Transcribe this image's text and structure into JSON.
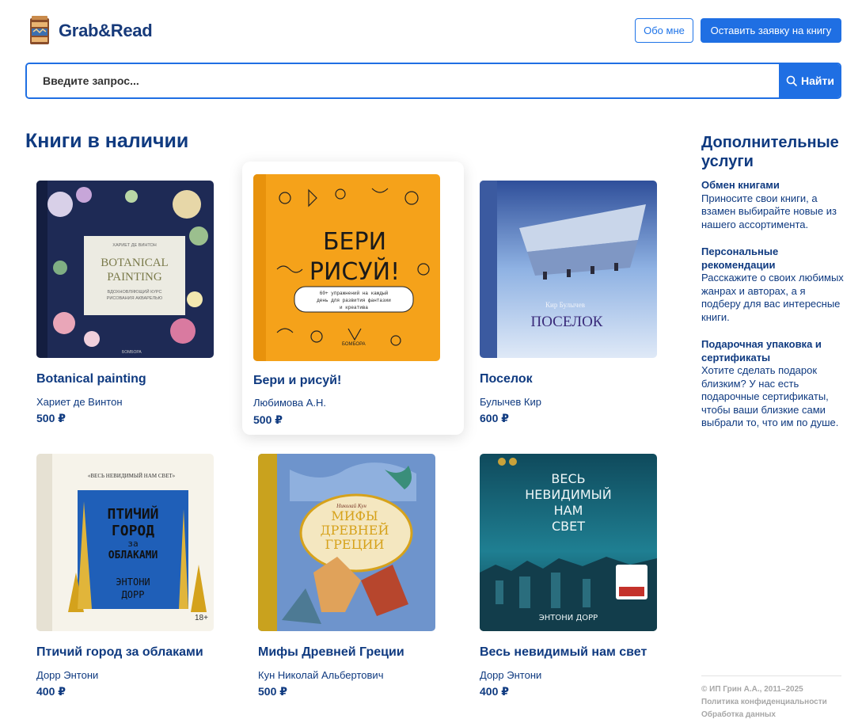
{
  "header": {
    "brand": "Grab&Read",
    "about_label": "Обо мне",
    "request_label": "Оставить заявку на книгу"
  },
  "search": {
    "placeholder": "Введите запрос...",
    "button_label": "Найти"
  },
  "catalog": {
    "title": "Книги в наличии",
    "books": [
      {
        "title": "Botanical painting",
        "author": "Хариет де Винтон",
        "price": "500 ₽",
        "cover_text": [
          "ХАРИЕТ ДЕ ВИНТОН",
          "BOTANICAL",
          "PAINTING",
          "ВДОХНОВЛЯЮЩИЙ КУРС",
          "РИСОВАНИЯ АКВАРЕЛЬЮ",
          "БОМБОРА"
        ]
      },
      {
        "title": "Бери и рисуй!",
        "author": "Любимова А.Н.",
        "price": "500 ₽",
        "cover_text": [
          "БЕРИ",
          "РИСУЙ!",
          "60+ упражнений на каждый",
          "день для развития фантазии",
          "и креатива",
          "БОМБОРА"
        ]
      },
      {
        "title": "Поселок",
        "author": "Булычев Кир",
        "price": "600 ₽",
        "cover_text": [
          "Кир Булычев",
          "ПОСЕЛОК"
        ]
      },
      {
        "title": "Птичий город за облаками",
        "author": "Дорр Энтони",
        "price": "400 ₽",
        "cover_text": [
          "«ВЕСЬ НЕВИДИМЫЙ НАМ СВЕТ»",
          "ПТИЧИЙ",
          "ГОРОД",
          "за",
          "ОБЛАКАМИ",
          "ЭНТОНИ",
          "ДОРР",
          "18+"
        ]
      },
      {
        "title": "Мифы Древней Греции",
        "author": "Кун Николай Альбертович",
        "price": "500 ₽",
        "cover_text": [
          "Николай Кун",
          "МИФЫ",
          "ДРЕВНЕЙ",
          "ГРЕЦИИ"
        ]
      },
      {
        "title": "Весь невидимый нам свет",
        "author": "Дорр Энтони",
        "price": "400 ₽",
        "cover_text": [
          "ВЕСЬ",
          "НЕВИДИМЫЙ",
          "НАМ",
          "СВЕТ",
          "ЭНТОНИ ДОРР"
        ]
      }
    ]
  },
  "services": {
    "title": "Дополнительные услуги",
    "items": [
      {
        "title": "Обмен книгами",
        "text": "Приносите свои книги, а взамен выбирайте новые из нашего ассортимента."
      },
      {
        "title": "Персональные рекомендации",
        "text": "Расскажите о своих любимых жанрах и авторах, а я подберу для вас интересные книги."
      },
      {
        "title": "Подарочная упаковка и сертификаты",
        "text": "Хотите сделать подарок близким? У нас есть подарочные сертификаты, чтобы ваши близкие сами выбрали то, что им по душе."
      }
    ]
  },
  "footer": {
    "copyright": "© ИП Грин А.А., 2011–2025",
    "privacy": "Политика конфиденциальности",
    "data_processing": "Обработка данных"
  },
  "colors": {
    "accent": "#1f6fe3",
    "heading": "#0f3a80"
  }
}
